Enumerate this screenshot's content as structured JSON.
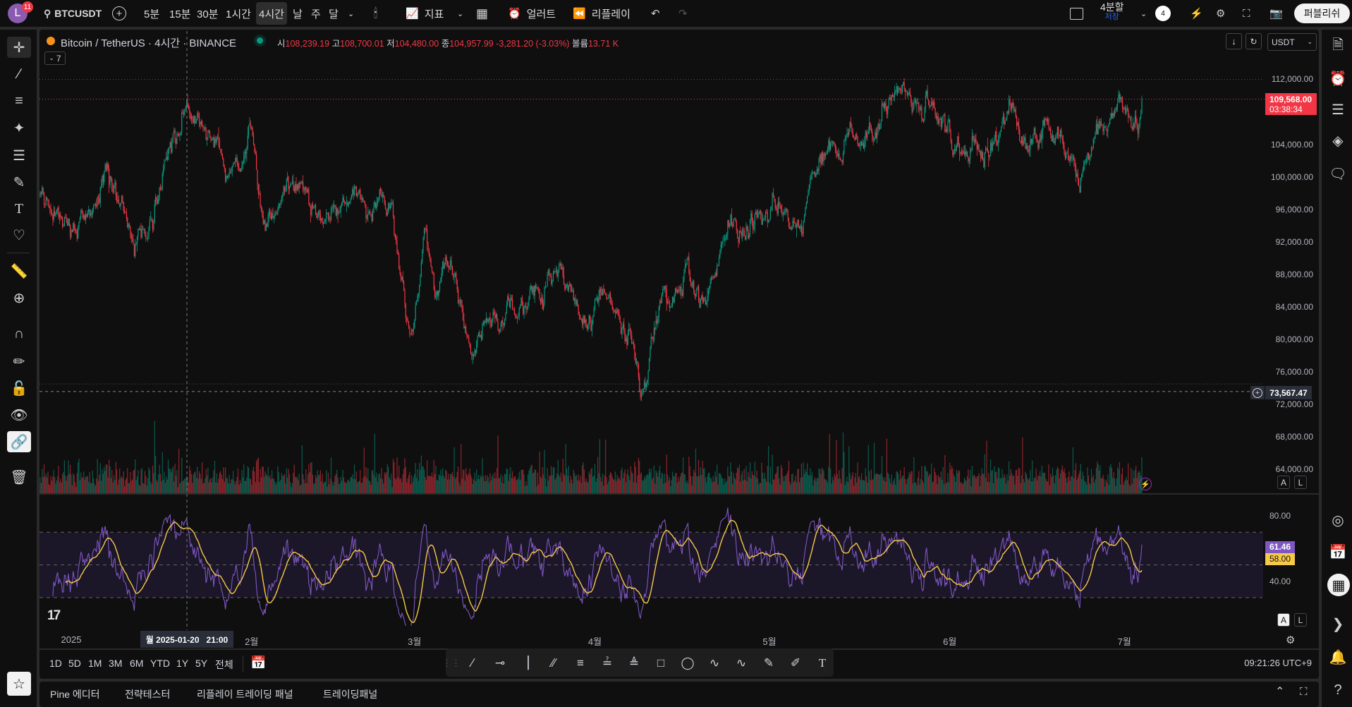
{
  "topbar": {
    "avatar_letter": "L",
    "notification_count": "11",
    "symbol": "BTCUSDT",
    "intervals": [
      "5분",
      "15분",
      "30분",
      "1시간",
      "4시간",
      "날",
      "주",
      "달"
    ],
    "active_interval": "4시간",
    "indicators_label": "지표",
    "alert_label": "얼러트",
    "replay_label": "리플레이",
    "layout_label": "4분할",
    "layout_sub": "저장",
    "layout_count": "4",
    "publish_label": "퍼블리쉬"
  },
  "legend": {
    "title": "Bitcoin / TetherUS · 4시간 · BINANCE",
    "open_label": "시",
    "open": "108,239.19",
    "high_label": "고",
    "high": "108,700.01",
    "low_label": "저",
    "low": "104,480.00",
    "close_label": "종",
    "close": "104,957.99",
    "change": "-3,281.20 (-3.03%)",
    "volume_label": "볼륨",
    "volume": "13.71 K",
    "collapse_count": "7",
    "currency": "USDT"
  },
  "price_axis": {
    "labels": [
      "112,000.00",
      "104,000.00",
      "100,000.00",
      "96,000.00",
      "92,000.00",
      "88,000.00",
      "84,000.00",
      "80,000.00",
      "76,000.00",
      "72,000.00",
      "68,000.00",
      "64,000.00"
    ],
    "last_price": "109,568.00",
    "countdown": "03:38:34",
    "crosshair_price": "73,567.47",
    "auto_label": "A",
    "log_label": "L"
  },
  "rsi_axis": {
    "labels": [
      "80.00",
      "40.00"
    ],
    "rsi_value": "61.46",
    "ma_value": "58.00"
  },
  "time_axis": {
    "labels": [
      {
        "text": "2025",
        "day": 0
      },
      {
        "text": "2월",
        "day": 31
      },
      {
        "text": "3월",
        "day": 59
      },
      {
        "text": "4월",
        "day": 90
      },
      {
        "text": "5월",
        "day": 120
      },
      {
        "text": "6월",
        "day": 151
      },
      {
        "text": "7월",
        "day": 181
      }
    ],
    "crosshair_label": "월 2025-01-20   21:00"
  },
  "range_bar": {
    "ranges": [
      "1D",
      "5D",
      "1M",
      "3M",
      "6M",
      "YTD",
      "1Y",
      "5Y",
      "전체"
    ],
    "clock": "09:21:26 UTC+9"
  },
  "bottom_tabs": [
    "Pine 에디터",
    "전략테스터",
    "리플레이 트레이딩 패널",
    "트레이딩패널"
  ],
  "colors": {
    "up": "#089981",
    "down": "#f23645",
    "rsi": "#7e57c2",
    "rsi_ma": "#f7c948",
    "accent_price": "#f23645"
  },
  "chart_data": {
    "type": "candlestick",
    "symbol": "BTCUSDT",
    "interval": "4h",
    "x_unit": "days since 2025-01-01",
    "xlim": [
      -5.5,
      184
    ],
    "ylim": [
      62000,
      116000
    ],
    "price_path": [
      [
        -5.5,
        97500
      ],
      [
        -0.4,
        93000
      ],
      [
        6.2,
        101000
      ],
      [
        9.2,
        95000
      ],
      [
        12.9,
        91000
      ],
      [
        15.9,
        101000
      ],
      [
        19.9,
        108500
      ],
      [
        23.3,
        104000
      ],
      [
        27,
        100000
      ],
      [
        30.7,
        105000
      ],
      [
        33.6,
        94000
      ],
      [
        36.6,
        98000
      ],
      [
        42.5,
        97000
      ],
      [
        47,
        96000
      ],
      [
        51.4,
        97500
      ],
      [
        55.1,
        95000
      ],
      [
        57.3,
        84000
      ],
      [
        58.8,
        79000
      ],
      [
        61,
        93000
      ],
      [
        62.5,
        84000
      ],
      [
        64.7,
        90000
      ],
      [
        69.2,
        78000
      ],
      [
        70.7,
        83000
      ],
      [
        76.6,
        84000
      ],
      [
        82.5,
        88000
      ],
      [
        88.4,
        83000
      ],
      [
        91.4,
        85000
      ],
      [
        94.4,
        82000
      ],
      [
        98.1,
        75500
      ],
      [
        100.3,
        82000
      ],
      [
        104.7,
        86000
      ],
      [
        109.2,
        85000
      ],
      [
        112.1,
        92000
      ],
      [
        116.6,
        94000
      ],
      [
        121.8,
        95500
      ],
      [
        125.5,
        93000
      ],
      [
        127.7,
        99000
      ],
      [
        129.9,
        104000
      ],
      [
        134.4,
        103000
      ],
      [
        138.8,
        106000
      ],
      [
        141.8,
        111000
      ],
      [
        144.7,
        107000
      ],
      [
        147,
        109000
      ],
      [
        150.7,
        104000
      ],
      [
        156.6,
        103000
      ],
      [
        161,
        109000
      ],
      [
        164,
        104000
      ],
      [
        167,
        106000
      ],
      [
        171.4,
        103000
      ],
      [
        173.6,
        99000
      ],
      [
        175.9,
        106000
      ],
      [
        180.3,
        108000
      ],
      [
        182.5,
        106000
      ],
      [
        184,
        109568
      ]
    ],
    "reference_lines": [
      112000,
      109568,
      74500,
      73567.47
    ],
    "rsi": {
      "period": 14,
      "ma_period": 14,
      "levels": [
        70,
        50,
        30
      ],
      "ylim": [
        13,
        93
      ],
      "last": 61.46,
      "ma_last": 58.0
    }
  }
}
